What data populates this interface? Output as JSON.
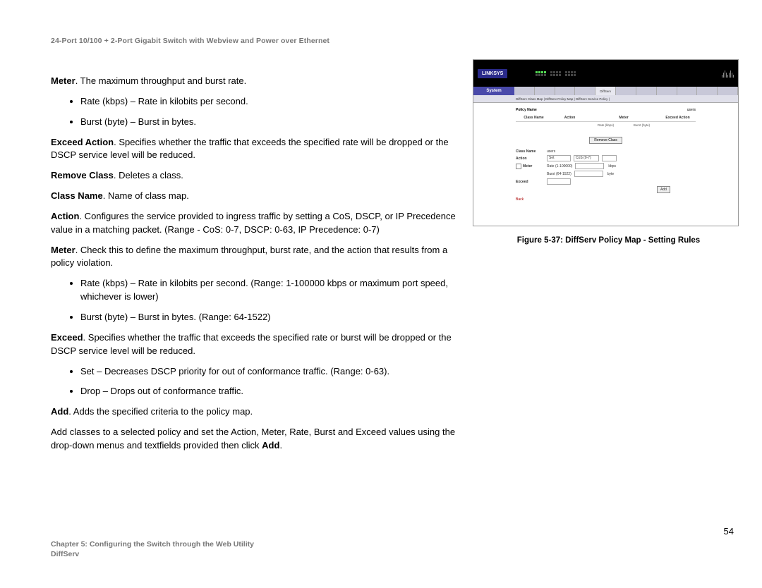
{
  "header": "24-Port 10/100 + 2-Port Gigabit Switch with Webview and Power over Ethernet",
  "body": {
    "meter_label": "Meter",
    "meter_text": ". The maximum throughput and burst rate.",
    "meter_bullets": [
      "Rate (kbps) – Rate in kilobits per second.",
      "Burst (byte) – Burst in bytes."
    ],
    "exceed_label": "Exceed Action",
    "exceed_text": ". Specifies whether the traffic that exceeds the specified rate will be dropped or the DSCP service level will be reduced.",
    "remove_label": "Remove Class",
    "remove_text": ". Deletes a class.",
    "classname_label": "Class Name",
    "classname_text": ". Name of class map.",
    "action_label": "Action",
    "action_text": ". Configures the service provided to ingress traffic by setting a CoS, DSCP, or IP Precedence value in a matching packet. (Range - CoS: 0-7, DSCP: 0-63, IP Precedence: 0-7)",
    "meter2_label": "Meter",
    "meter2_text": ". Check this to define the maximum throughput, burst rate, and the action that results from a policy violation.",
    "meter2_bullets": [
      "Rate (kbps) – Rate in kilobits per second. (Range: 1-100000 kbps or maximum port speed, whichever is lower)",
      "Burst (byte) – Burst in bytes. (Range: 64-1522)"
    ],
    "exceed2_label": "Exceed",
    "exceed2_text": ". Specifies whether the traffic that exceeds the specified rate or burst will be dropped or the DSCP service level will be reduced.",
    "exceed2_bullets": [
      "Set – Decreases DSCP priority for out of conformance traffic. (Range: 0-63).",
      "Drop – Drops out of conformance traffic."
    ],
    "add_label": "Add",
    "add_text": ". Adds the specified criteria to the policy map.",
    "closing_pre": "Add classes to a selected policy and set the Action, Meter, Rate, Burst and Exceed values using the drop-down menus and textfields provided then click ",
    "closing_bold": "Add",
    "closing_post": "."
  },
  "figure": {
    "logo": "LINKSYS",
    "system_label": "System",
    "subtabs": "DiffServ Class Map | DiffServ Policy Map | DiffServ Service Policy |",
    "policy_name_label": "Policy Name",
    "policy_name_value": "users",
    "th_class": "Class Name",
    "th_action": "Action",
    "th_meter": "Meter",
    "th_exceed": "Exceed Action",
    "sub_rate": "Rate (kbps)",
    "sub_burst": "Burst (byte)",
    "remove_btn": "Remove Class",
    "form_class_label": "Class Name",
    "form_class_value": "users",
    "form_action_label": "Action",
    "form_action_select": "Set",
    "form_action_val": "CoS (0-7)",
    "form_meter_label": "Meter",
    "form_rate_label": "Rate (1-100000)",
    "form_rate_unit": "kbps",
    "form_burst_label": "Burst (64-1522)",
    "form_burst_unit": "byte",
    "form_exceed_label": "Exceed",
    "add_btn": "Add",
    "back": "Back",
    "caption": "Figure 5-37: DiffServ Policy Map - Setting Rules"
  },
  "footer": {
    "page": "54",
    "chapter": "Chapter 5: Configuring the Switch through the Web Utility",
    "section": "DiffServ"
  }
}
